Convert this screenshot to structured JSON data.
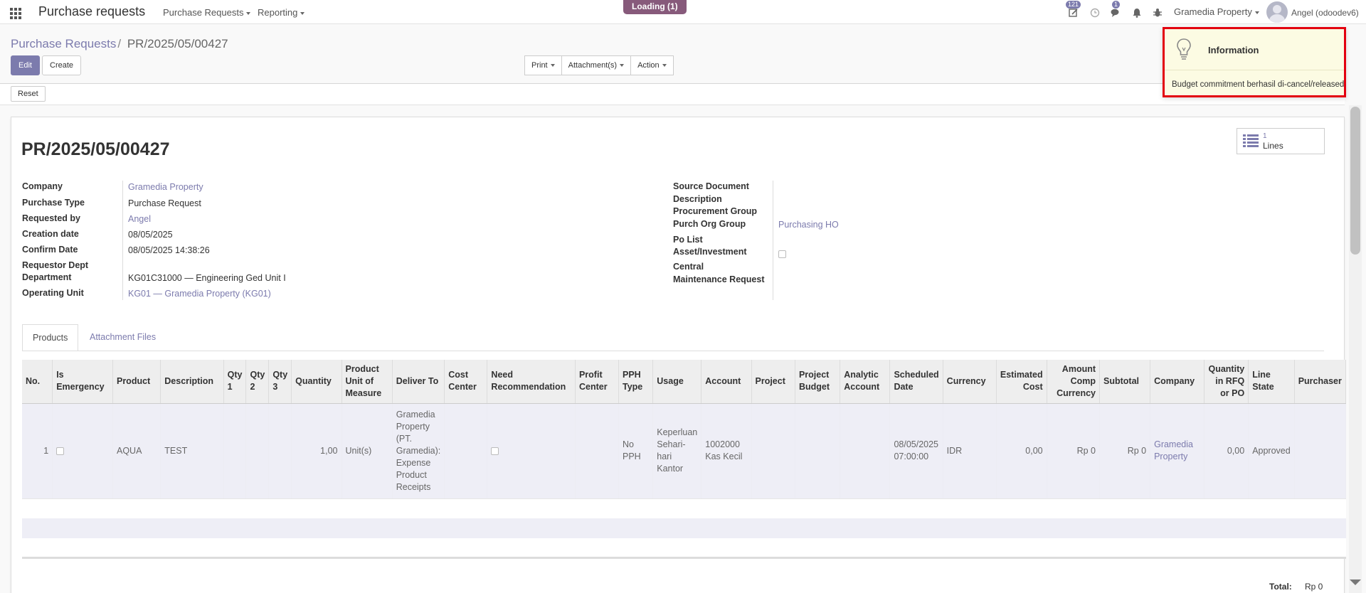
{
  "navbar": {
    "app_title": "Purchase requests",
    "menu_purchase_requests": "Purchase Requests",
    "menu_reporting": "Reporting",
    "loading": "Loading (1)",
    "activity_badge": "121",
    "messages_badge": "1",
    "company_switch": "Gramedia Property",
    "user_name": "Angel (odoodev6)"
  },
  "breadcrumb": {
    "parent": "Purchase Requests",
    "separator": "/",
    "current": "PR/2025/05/00427"
  },
  "buttons": {
    "edit": "Edit",
    "create": "Create",
    "print": "Print",
    "attachments": "Attachment(s)",
    "action": "Action",
    "reset": "Reset"
  },
  "record": {
    "title": "PR/2025/05/00427",
    "smart_button": {
      "count": "1",
      "label": "Lines"
    }
  },
  "left_fields": {
    "company_label": "Company",
    "company_value": "Gramedia Property",
    "purchase_type_label": "Purchase Type",
    "purchase_type_value": "Purchase Request",
    "requested_by_label": "Requested by",
    "requested_by_value": "Angel",
    "creation_date_label": "Creation date",
    "creation_date_value": "08/05/2025",
    "confirm_date_label": "Confirm Date",
    "confirm_date_value": "08/05/2025 14:38:26",
    "requestor_dept_label_1": "Requestor Dept",
    "requestor_dept_label_2": "Department",
    "requestor_dept_value": "KG01C31000 — Engineering Ged Unit I",
    "operating_unit_label": "Operating Unit",
    "operating_unit_value": "KG01 — Gramedia Property (KG01)"
  },
  "right_fields": {
    "source_document_label": "Source Document",
    "description_label": "Description",
    "procurement_group_label": "Procurement Group",
    "purch_org_group_label": "Purch Org Group",
    "purch_org_group_value": "Purchasing HO",
    "po_list_label": "Po List",
    "asset_investment_label": "Asset/Investment",
    "central_label": "Central",
    "maintenance_request_label": "Maintenance Request"
  },
  "tabs": {
    "products": "Products",
    "attachment_files": "Attachment Files"
  },
  "table": {
    "headers": [
      "No.",
      "Is Emergency",
      "Product",
      "Description",
      "Qty 1",
      "Qty 2",
      "Qty 3",
      "Quantity",
      "Product Unit of Measure",
      "Deliver To",
      "Cost Center",
      "Need Recommendation",
      "Profit Center",
      "PPH Type",
      "Usage",
      "Account",
      "Project",
      "Project Budget",
      "Analytic Account",
      "Scheduled Date",
      "Currency",
      "Estimated Cost",
      "Amount Comp Currency",
      "Subtotal",
      "Company",
      "Quantity in RFQ or PO",
      "Line State",
      "Purchaser"
    ],
    "row": {
      "no": "1",
      "product": "AQUA",
      "description": "TEST",
      "quantity": "1,00",
      "uom": "Unit(s)",
      "deliver_to": "Gramedia Property (PT. Gramedia): Expense Product Receipts",
      "pph_type": "No PPH",
      "usage": "Keperluan Sehari-hari Kantor",
      "account": "1002000 Kas Kecil",
      "scheduled_date": "08/05/2025 07:00:00",
      "currency": "IDR",
      "estimated_cost": "0,00",
      "amount_comp_currency": "Rp 0",
      "subtotal": "Rp 0",
      "company": "Gramedia Property",
      "qty_rfq_po": "0,00",
      "line_state": "Approved"
    }
  },
  "footer": {
    "total_label": "Total:",
    "total_value": "Rp 0"
  },
  "notification": {
    "title": "Information",
    "message": "Budget commitment berhasil di-cancel/released"
  },
  "colors": {
    "accent": "#7c7bad",
    "brand": "#875a7b",
    "highlight_border": "#e3000f",
    "notification_bg": "#fcfbe3"
  }
}
